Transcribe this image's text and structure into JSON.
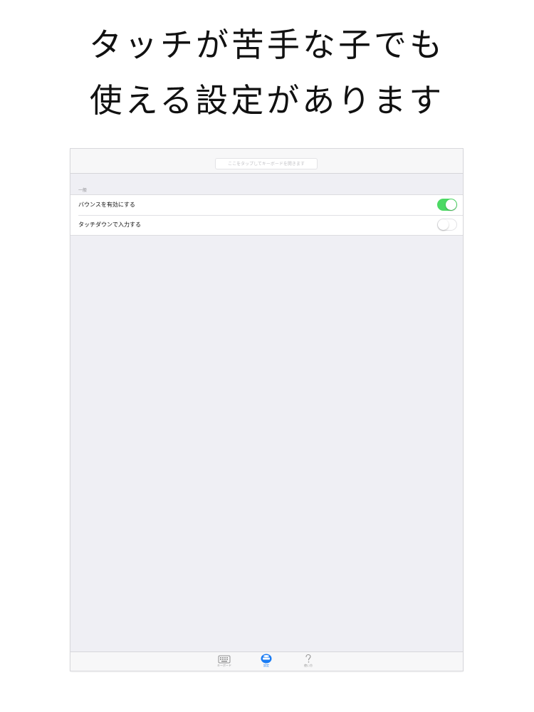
{
  "promo": {
    "line1": "タッチが苦手な子でも",
    "line2": "使える設定があります"
  },
  "navbar": {
    "search_placeholder": "ここをタップしてキーボードを開きます"
  },
  "settings": {
    "section_header": "一般",
    "rows": [
      {
        "label": "バウンスを有効にする",
        "toggle": true
      },
      {
        "label": "タッチダウンで入力する",
        "toggle": false
      }
    ]
  },
  "tabbar": {
    "tabs": [
      {
        "label": "キーボード",
        "icon": "keyboard-icon",
        "active": false
      },
      {
        "label": "設定",
        "icon": "settings-icon",
        "active": true
      },
      {
        "label": "使い方",
        "icon": "question-mark-icon",
        "active": false
      }
    ]
  },
  "colors": {
    "toggle_on": "#4cd964",
    "active_tab": "#1a7cf4",
    "inactive_tab": "#929292",
    "background": "#efeff4"
  }
}
